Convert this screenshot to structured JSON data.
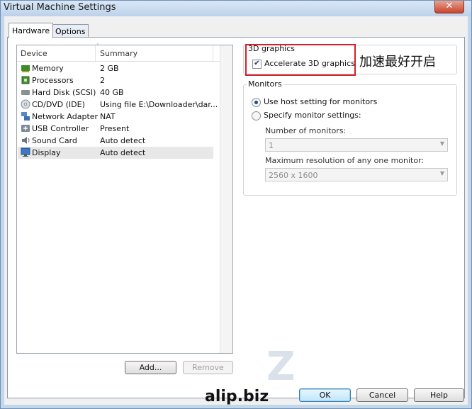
{
  "window": {
    "title": "Virtual Machine Settings",
    "close_glyph": "✕"
  },
  "tabs": [
    {
      "label": "Hardware",
      "active": true
    },
    {
      "label": "Options",
      "active": false
    }
  ],
  "device_list": {
    "columns": {
      "device": "Device",
      "summary": "Summary"
    },
    "rows": [
      {
        "name": "Memory",
        "summary": "2 GB",
        "icon": "memory-icon"
      },
      {
        "name": "Processors",
        "summary": "2",
        "icon": "processor-icon"
      },
      {
        "name": "Hard Disk (SCSI)",
        "summary": "40 GB",
        "icon": "hard-disk-icon"
      },
      {
        "name": "CD/DVD (IDE)",
        "summary": "Using file E:\\Downloader\\dar...",
        "icon": "cd-dvd-icon"
      },
      {
        "name": "Network Adapter",
        "summary": "NAT",
        "icon": "network-adapter-icon"
      },
      {
        "name": "USB Controller",
        "summary": "Present",
        "icon": "usb-icon"
      },
      {
        "name": "Sound Card",
        "summary": "Auto detect",
        "icon": "sound-card-icon"
      },
      {
        "name": "Display",
        "summary": "Auto detect",
        "icon": "display-icon",
        "selected": true
      }
    ]
  },
  "list_buttons": {
    "add": "Add...",
    "remove": "Remove"
  },
  "graphics_3d": {
    "label": "3D graphics",
    "accelerate_label": "Accelerate 3D graphics",
    "accelerate_checked": true,
    "check_glyph": "✔"
  },
  "annotation_text": "加速最好开启",
  "monitors": {
    "label": "Monitors",
    "use_host_label": "Use host setting for monitors",
    "specify_label": "Specify monitor settings:",
    "selected_option": "use_host",
    "number_label": "Number of monitors:",
    "number_value": "1",
    "max_res_label": "Maximum resolution of any one monitor:",
    "max_res_value": "2560 x 1600",
    "dropdown_glyph": "▼"
  },
  "watermark_text": "alip.biz",
  "dialog_buttons": {
    "ok": "OK",
    "cancel": "Cancel",
    "help": "Help"
  },
  "colors": {
    "highlight": "#d4202a",
    "title_bar": "#c2d6ec"
  }
}
